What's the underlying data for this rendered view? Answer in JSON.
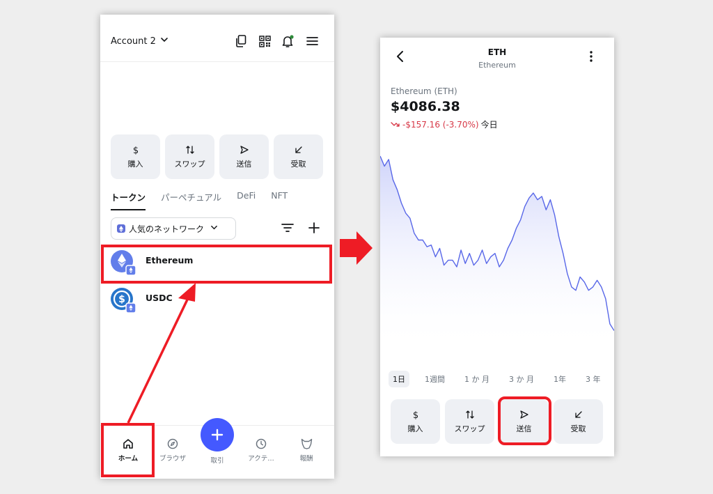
{
  "left": {
    "header": {
      "account": "Account 2"
    },
    "actions": [
      {
        "label": "購入",
        "icon": "dollar-icon"
      },
      {
        "label": "スワップ",
        "icon": "swap-icon"
      },
      {
        "label": "送信",
        "icon": "send-icon"
      },
      {
        "label": "受取",
        "icon": "receive-icon"
      }
    ],
    "tabs": [
      "トークン",
      "パーペチュアル",
      "DeFi",
      "NFT"
    ],
    "network": "人気のネットワーク",
    "tokens": [
      {
        "name": "Ethereum"
      },
      {
        "name": "USDC"
      }
    ],
    "nav": [
      "ホーム",
      "ブラウザ",
      "取引",
      "アクテ…",
      "報酬"
    ]
  },
  "right": {
    "title": "ETH",
    "subtitle": "Ethereum",
    "asset_name": "Ethereum (ETH)",
    "price": "$4086.38",
    "change": "-$157.16 (-3.70%)",
    "change_period": "今日",
    "ranges": [
      "1日",
      "1週間",
      "1 か 月",
      "3 か 月",
      "1年",
      "3 年"
    ],
    "actions": [
      {
        "label": "購入",
        "icon": "dollar-icon"
      },
      {
        "label": "スワップ",
        "icon": "swap-icon"
      },
      {
        "label": "送信",
        "icon": "send-icon"
      },
      {
        "label": "受取",
        "icon": "receive-icon"
      }
    ]
  },
  "colors": {
    "accent": "#4459ff",
    "negative": "#d73847",
    "annotation": "#ee1c25",
    "chart_line": "#5867e8"
  },
  "chart_data": {
    "type": "area",
    "title": "",
    "x": [
      0,
      1,
      2,
      3,
      4,
      5,
      6,
      7,
      8,
      9,
      10,
      11,
      12,
      13,
      14,
      15,
      16,
      17,
      18,
      19,
      20,
      21,
      22,
      23,
      24,
      25,
      26,
      27,
      28,
      29,
      30,
      31,
      32,
      33,
      34,
      35,
      36,
      37,
      38,
      39,
      40,
      41,
      42,
      43,
      44,
      45,
      46,
      47,
      48,
      49,
      50,
      51,
      52,
      53,
      54,
      55
    ],
    "values": [
      100,
      94,
      98,
      86,
      80,
      72,
      66,
      63,
      54,
      50,
      50,
      46,
      47,
      40,
      45,
      35,
      38,
      38,
      34,
      44,
      36,
      42,
      35,
      38,
      44,
      36,
      40,
      42,
      34,
      38,
      45,
      50,
      57,
      62,
      70,
      75,
      78,
      74,
      76,
      68,
      74,
      65,
      52,
      42,
      30,
      22,
      20,
      28,
      25,
      20,
      22,
      26,
      22,
      15,
      0,
      -4
    ],
    "ylim": [
      -10,
      105
    ],
    "grid": false
  }
}
